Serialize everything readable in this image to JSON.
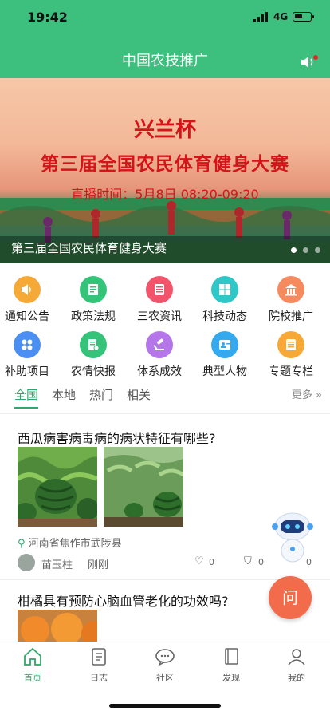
{
  "status": {
    "time": "19:42",
    "network": "4G"
  },
  "header": {
    "title": "中国农技推广"
  },
  "banner": {
    "line1": "兴兰杯",
    "line2": "第三届全国农民体育健身大赛",
    "line3": "直播时间：5月8日 08:20-09:20",
    "caption": "第三届全国农民体育健身大赛"
  },
  "grid": [
    {
      "label": "通知公告",
      "icon": "speaker-icon",
      "color": "#f7a937"
    },
    {
      "label": "政策法规",
      "icon": "document-icon",
      "color": "#35c37a"
    },
    {
      "label": "三农资讯",
      "icon": "news-icon",
      "color": "#f2556b"
    },
    {
      "label": "科技动态",
      "icon": "windows-icon",
      "color": "#2fc7c7"
    },
    {
      "label": "院校推广",
      "icon": "school-icon",
      "color": "#f58a5f"
    },
    {
      "label": "补助项目",
      "icon": "grid-icon",
      "color": "#4b8ff2"
    },
    {
      "label": "农情快报",
      "icon": "report-icon",
      "color": "#35c37a"
    },
    {
      "label": "体系成效",
      "icon": "gavel-icon",
      "color": "#b476e8"
    },
    {
      "label": "典型人物",
      "icon": "person-card-icon",
      "color": "#35a9ee"
    },
    {
      "label": "专题专栏",
      "icon": "topic-icon",
      "color": "#f7a937"
    }
  ],
  "tabs": [
    "全国",
    "本地",
    "热门",
    "相关"
  ],
  "more_label": "更多",
  "articles": [
    {
      "title": "西瓜病害病毒病的病状特征有哪些?",
      "location": "河南省焦作市武陟县",
      "author": "苗玉柱",
      "time": "刚刚",
      "likes": "0",
      "favorites": "0",
      "comments": "0"
    },
    {
      "title": "柑橘具有预防心脑血管老化的功效吗?"
    }
  ],
  "ask_label": "问",
  "bottom_nav": [
    "首页",
    "日志",
    "社区",
    "发现",
    "我的"
  ]
}
